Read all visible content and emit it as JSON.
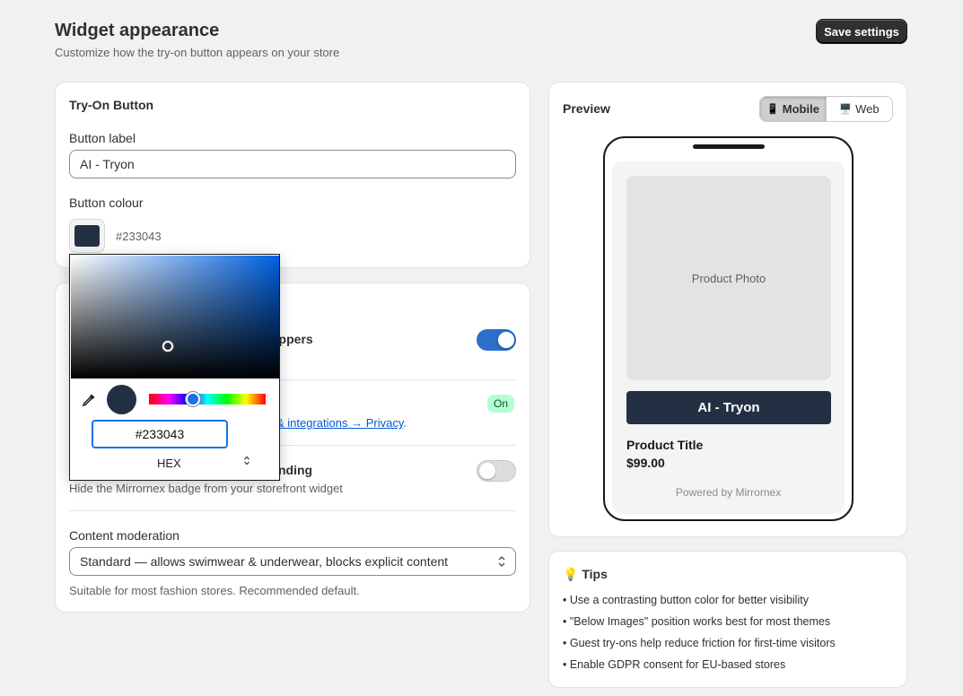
{
  "header": {
    "title": "Widget appearance",
    "subtitle": "Customize how the try-on button appears on your store",
    "save_label": "Save settings"
  },
  "tryon_card": {
    "title": "Try-On Button",
    "label_field_label": "Button label",
    "label_field_value": "AI - Tryon",
    "colour_label": "Button colour",
    "colour_value": "#233043"
  },
  "settings_card": {
    "guest": {
      "title_visible": "oppers",
      "enabled": true
    },
    "gdpr": {
      "badge": "On",
      "help_link": "& integrations → Privacy",
      "help_suffix": "."
    },
    "branding": {
      "title_visible": "nding",
      "help": "Hide the Mirrornex badge from your storefront widget",
      "enabled": false
    },
    "moderation": {
      "label": "Content moderation",
      "selected": "Standard — allows swimwear & underwear, blocks explicit content",
      "help": "Suitable for most fashion stores. Recommended default."
    }
  },
  "color_picker": {
    "hex_value": "#233043",
    "mode": "HEX",
    "mode_toggle": "⌃⌄",
    "saturation_color": "#0061e0"
  },
  "preview_card": {
    "title": "Preview",
    "modes": [
      {
        "icon": "📱",
        "label": "Mobile",
        "active": true
      },
      {
        "icon": "🖥️",
        "label": "Web",
        "active": false
      }
    ],
    "phone": {
      "photo_label": "Product Photo",
      "button_label": "AI - Tryon",
      "product_title": "Product Title",
      "price": "$99.00",
      "powered_by": "Powered by Mirrornex"
    }
  },
  "tips_card": {
    "icon": "💡",
    "title": "Tips",
    "items": [
      "• Use a contrasting button color for better visibility",
      "• \"Below Images\" position works best for most themes",
      "• Guest try-ons help reduce friction for first-time visitors",
      "• Enable GDPR consent for EU-based stores"
    ]
  },
  "colors": {
    "accent": "#2c6ecb",
    "button_colour": "#233043"
  }
}
